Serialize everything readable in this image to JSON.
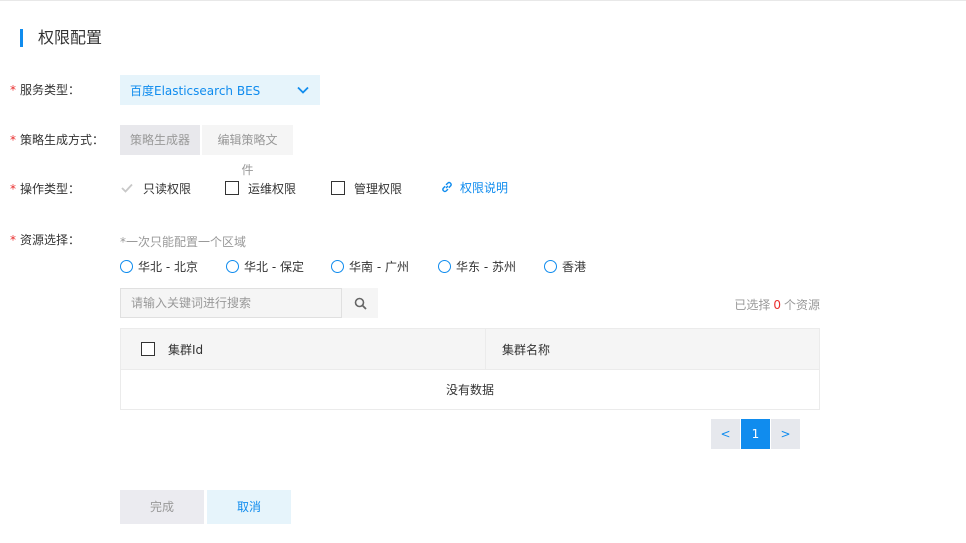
{
  "section_title": "权限配置",
  "form": {
    "required_mark": "*",
    "service_type": {
      "label": "服务类型：",
      "selected": "百度Elasticsearch BES",
      "icon": "chevron-down-icon"
    },
    "policy_mode": {
      "label": "策略生成方式：",
      "options": [
        "策略生成器",
        "编辑策略文件"
      ],
      "selected": "策略生成器"
    },
    "operation_type": {
      "label": "操作类型：",
      "options": [
        {
          "label": "只读权限",
          "checked": true,
          "disabled": true
        },
        {
          "label": "运维权限",
          "checked": false
        },
        {
          "label": "管理权限",
          "checked": false
        }
      ],
      "help_link": "权限说明",
      "help_icon": "link-icon"
    },
    "resource": {
      "label": "资源选择：",
      "hint": "*一次只能配置一个区域",
      "regions": [
        "华北 - 北京",
        "华北 - 保定",
        "华南 - 广州",
        "华东 - 苏州",
        "香港"
      ],
      "search_placeholder": "请输入关键词进行搜索",
      "search_icon": "search-icon",
      "selected_prefix": "已选择",
      "selected_count": "0",
      "selected_suffix": "个资源",
      "table": {
        "columns": [
          "集群Id",
          "集群名称"
        ],
        "empty_text": "没有数据"
      },
      "pagination": {
        "prev": "<",
        "current": "1",
        "next": ">"
      }
    }
  },
  "footer": {
    "done": "完成",
    "cancel": "取消"
  },
  "colors": {
    "accent": "#108cee",
    "required": "#ea2e2e"
  }
}
